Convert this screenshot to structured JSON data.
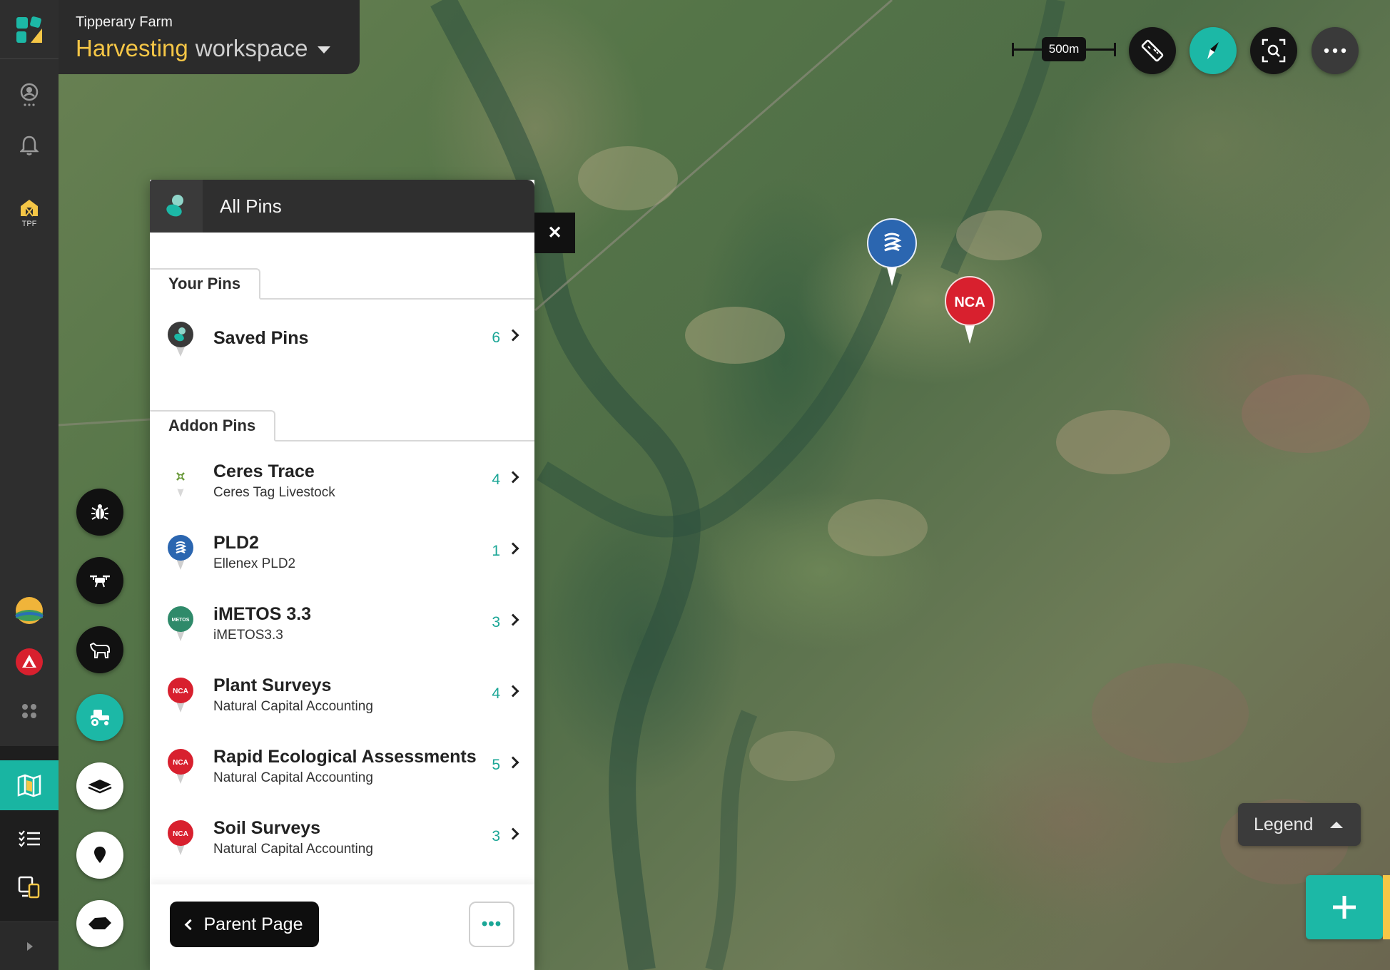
{
  "workspace": {
    "farm_name": "Tipperary Farm",
    "title_highlight": "Harvesting",
    "title_rest": "workspace"
  },
  "sidebar": {
    "farm_badge_label": "TPF"
  },
  "toolbar": {
    "scale_label": "500m"
  },
  "panel": {
    "title": "All Pins",
    "your_pins_tab": "Your Pins",
    "addon_pins_tab": "Addon Pins",
    "your_pins": [
      {
        "name": "Saved Pins",
        "count": "6"
      }
    ],
    "addon_pins": [
      {
        "name": "Ceres Trace",
        "subtitle": "Ceres Tag Livestock",
        "count": "4",
        "icon": "ceres-icon"
      },
      {
        "name": "PLD2",
        "subtitle": "Ellenex PLD2",
        "count": "1",
        "icon": "pld2-icon"
      },
      {
        "name": "iMETOS 3.3",
        "subtitle": "iMETOS3.3",
        "count": "3",
        "icon": "metos-icon"
      },
      {
        "name": "Plant Surveys",
        "subtitle": "Natural Capital Accounting",
        "count": "4",
        "icon": "nca-icon"
      },
      {
        "name": "Rapid Ecological Assessments",
        "subtitle": "Natural Capital Accounting",
        "count": "5",
        "icon": "nca-icon"
      },
      {
        "name": "Soil Surveys",
        "subtitle": "Natural Capital Accounting",
        "count": "3",
        "icon": "nca-icon"
      }
    ],
    "metos_badge": "METOS",
    "nca_badge": "NCA",
    "parent_page_label": "Parent Page",
    "more_label": "•••",
    "close_label": "✕"
  },
  "map": {
    "marker_nca_label": "NCA"
  },
  "legend": {
    "label": "Legend"
  },
  "colors": {
    "accent_teal": "#1cb8a6",
    "accent_yellow": "#f5c646",
    "nca_red": "#d8202e",
    "pld2_blue": "#2b66b0",
    "metos_green": "#2f8a6a"
  }
}
